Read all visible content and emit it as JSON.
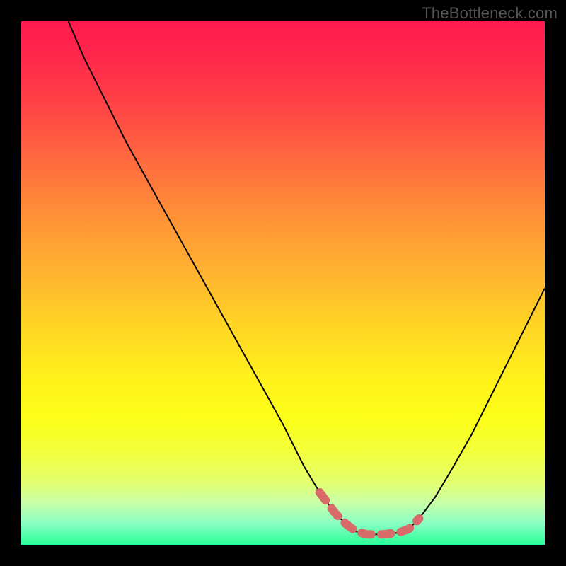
{
  "watermark": "TheBottleneck.com",
  "colors": {
    "page_bg": "#000000",
    "curve": "#000000",
    "highlight": "#d96a6a",
    "gradient_top": "#ff1a4d",
    "gradient_bottom": "#29ff98"
  },
  "chart_data": {
    "type": "line",
    "title": "",
    "xlabel": "",
    "ylabel": "",
    "xlim": [
      0,
      100
    ],
    "ylim": [
      0,
      100
    ],
    "grid": false,
    "note": "V-shaped bottleneck curve. x = relative performance index (arbitrary 0-100). y = bottleneck severity (0 = none, 100 = max). Background vertical gradient encodes severity (red high → green low). A short salmon segment highlights the near-zero bottleneck region around the minimum.",
    "series": [
      {
        "name": "bottleneck-curve",
        "color": "#000000",
        "x": [
          9,
          12,
          16,
          20,
          25,
          30,
          35,
          40,
          45,
          50,
          54,
          57,
          60,
          62,
          64,
          66,
          69,
          72,
          74,
          76,
          79,
          82,
          86,
          90,
          94,
          98,
          100
        ],
        "y": [
          100,
          93,
          85,
          77,
          68,
          59,
          50,
          41,
          32,
          23,
          15,
          10,
          6,
          4,
          2.5,
          2,
          2,
          2.3,
          3,
          5,
          9,
          14,
          21,
          29,
          37,
          45,
          49
        ]
      },
      {
        "name": "optimal-region-highlight",
        "color": "#d96a6a",
        "x": [
          57,
          60,
          62,
          64,
          66,
          69,
          72,
          74,
          76
        ],
        "y": [
          10,
          6,
          4,
          2.5,
          2,
          2,
          2.3,
          3,
          5
        ]
      }
    ]
  }
}
